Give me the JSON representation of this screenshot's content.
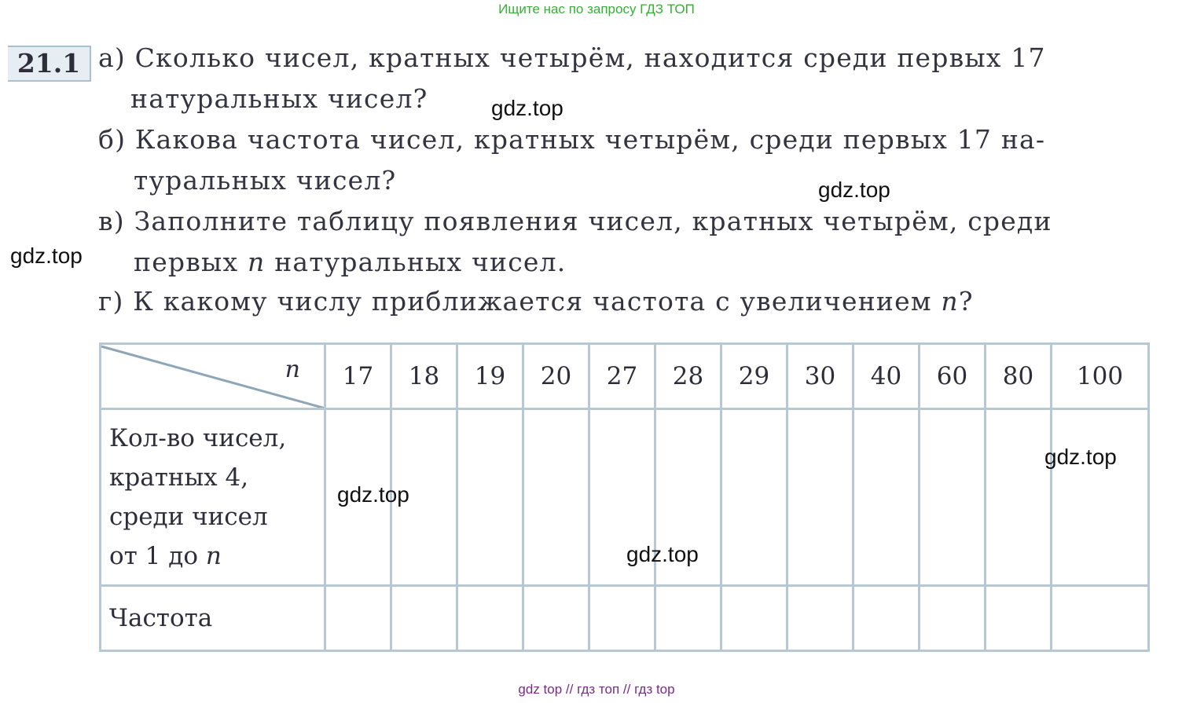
{
  "banner": "Ищите нас по запросу ГДЗ ТОП",
  "problem_number": "21.1",
  "tasks": {
    "a": {
      "letter": "а)",
      "line1": "Сколько чисел, кратных четырём, находится среди первых 17",
      "line2": "натуральных чисел?"
    },
    "b": {
      "letter": "б)",
      "line1": "Какова частота чисел, кратных четырём, среди первых 17 на-",
      "line2": "туральных чисел?"
    },
    "v": {
      "letter": "в)",
      "line1": "Заполните таблицу появления чисел, кратных четырём, среди",
      "line2_pre": "первых",
      "line2_var": "n",
      "line2_post": "натуральных чисел."
    },
    "g": {
      "letter": "г)",
      "text_pre": "К какому числу приближается частота с увеличением",
      "text_var": "n",
      "text_post": "?"
    }
  },
  "table": {
    "corner_label": "n",
    "columns": [
      "17",
      "18",
      "19",
      "20",
      "27",
      "28",
      "29",
      "30",
      "40",
      "60",
      "80",
      "100"
    ],
    "row1_label": {
      "line1": "Кол-во чисел,",
      "line2": "кратных 4,",
      "line3": "среди чисел",
      "line4_pre": "от 1 до",
      "line4_var": "n"
    },
    "row2_label": "Частота"
  },
  "watermarks": [
    "gdz.top",
    "gdz.top",
    "gdz.top",
    "gdz.top",
    "gdz.top",
    "gdz.top"
  ],
  "footer": "gdz top  //  гдз топ  //  гдз top"
}
